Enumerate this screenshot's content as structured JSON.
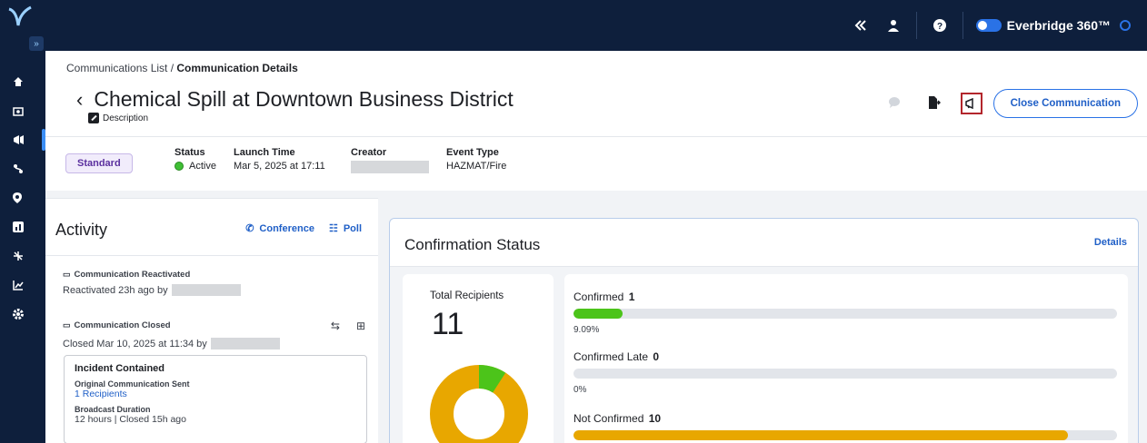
{
  "topbar": {
    "brand": "Everbridge 360™"
  },
  "header": {
    "breadcrumb_parent": "Communications List",
    "breadcrumb_sep": " / ",
    "breadcrumb_current": "Communication Details",
    "title": "Chemical Spill at Downtown Business District",
    "description_label": "Description",
    "close_label": "Close Communication"
  },
  "meta": {
    "type_badge": "Standard",
    "status_label": "Status",
    "status_value": "Active",
    "status_color": "#3fbf35",
    "launch_label": "Launch Time",
    "launch_value": "Mar 5, 2025 at 17:11",
    "creator_label": "Creator",
    "event_label": "Event Type",
    "event_value": "HAZMAT/Fire"
  },
  "activity": {
    "title": "Activity",
    "conference_label": "Conference",
    "poll_label": "Poll",
    "events": [
      {
        "label": "Communication Reactivated",
        "detail": "Reactivated 23h ago by"
      },
      {
        "label": "Communication Closed",
        "detail": "Closed Mar 10, 2025 at 11:34 by"
      }
    ],
    "incident": {
      "title": "Incident Contained",
      "orig_label": "Original Communication Sent",
      "orig_value": "1 Recipients",
      "duration_label": "Broadcast Duration",
      "duration_value": "12 hours | Closed 15h ago"
    }
  },
  "confirmation": {
    "title": "Confirmation Status",
    "details_label": "Details",
    "total_label": "Total Recipients",
    "total_value": "11",
    "stats": [
      {
        "label": "Confirmed",
        "count": "1",
        "percent_text": "9.09%",
        "fraction": 0.0909,
        "color": "#4cc41a"
      },
      {
        "label": "Confirmed Late",
        "count": "0",
        "percent_text": "0%",
        "fraction": 0,
        "color": "#4cc41a"
      },
      {
        "label": "Not Confirmed",
        "count": "10",
        "fraction": 0.9091,
        "color": "#e8a700"
      }
    ]
  }
}
